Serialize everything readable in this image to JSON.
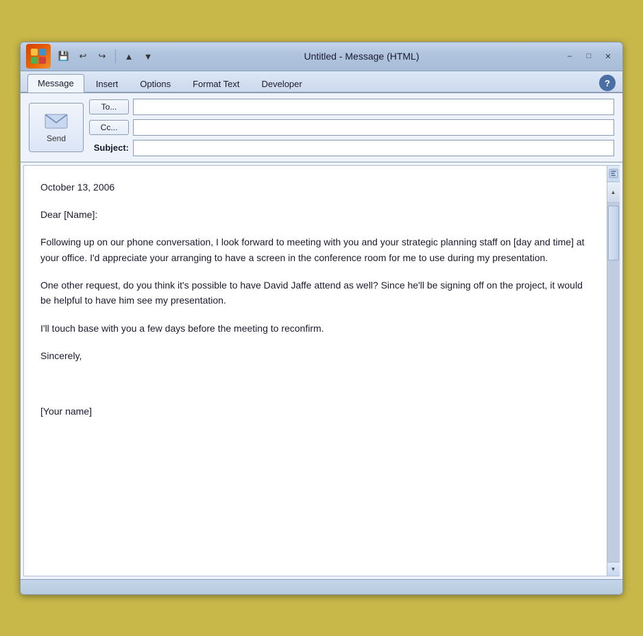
{
  "window": {
    "title": "Untitled - Message (HTML)",
    "title_full": "Untitled - Message (HTML)"
  },
  "titlebar": {
    "save_icon": "💾",
    "undo_icon": "↩",
    "redo_icon": "↪",
    "up_icon": "▲",
    "down_icon": "▼"
  },
  "ribbon": {
    "tabs": [
      {
        "label": "Message",
        "active": true
      },
      {
        "label": "Insert",
        "active": false
      },
      {
        "label": "Options",
        "active": false
      },
      {
        "label": "Format Text",
        "active": false
      },
      {
        "label": "Developer",
        "active": false
      }
    ],
    "help_label": "?"
  },
  "form": {
    "to_label": "To...",
    "cc_label": "Cc...",
    "subject_label": "Subject:",
    "to_value": "",
    "cc_value": "",
    "subject_value": "",
    "send_label": "Send"
  },
  "email_body": {
    "date": "October 13, 2006",
    "greeting": "Dear [Name]:",
    "paragraph1": "Following up on our phone conversation, I look forward to meeting with you and your strategic planning staff on [day and time] at your office. I'd appreciate your arranging to have a screen in the conference room for me to use during my presentation.",
    "paragraph2": "One other request, do you think it's possible to have David Jaffe attend as well? Since he'll be signing off on the project, it would be helpful to have him see my presentation.",
    "paragraph3": "I'll touch base with you a few days before the meeting to reconfirm.",
    "closing": "Sincerely,",
    "signature": "[Your name]"
  },
  "status_bar": {
    "text": ""
  }
}
